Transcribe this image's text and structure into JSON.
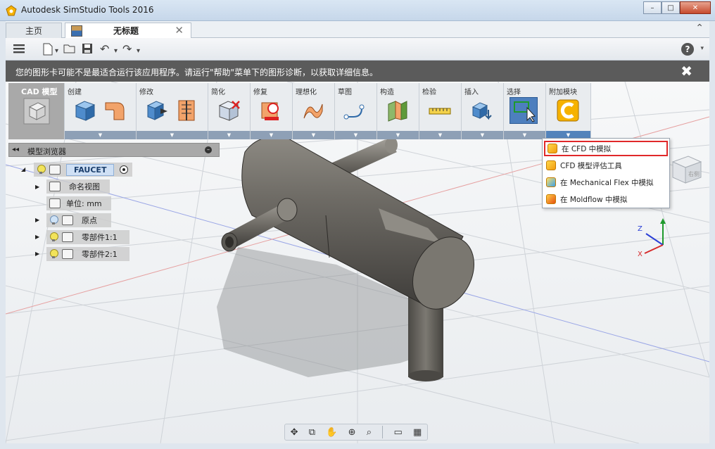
{
  "window": {
    "title": "Autodesk SimStudio Tools 2016",
    "minimize": "–",
    "maximize": "□",
    "close": "✕"
  },
  "tabs": {
    "home": "主页",
    "document": "无标题",
    "close_glyph": "✕",
    "collapse_glyph": "⌃"
  },
  "quick_toolbar": {
    "help_glyph": "?",
    "help_caret": "▾"
  },
  "warning": {
    "text": "您的图形卡可能不是最适合运行该应用程序。请运行\"帮助\"菜单下的图形诊断，以获取详细信息。",
    "close_glyph": "✖"
  },
  "ribbon": {
    "groups": [
      {
        "label": "CAD 模型",
        "icon": "cube-outline-icon"
      },
      {
        "label": "创建",
        "icon": "box-icon"
      },
      {
        "label": "修改",
        "icon": "press-pull-icon"
      },
      {
        "label": "简化",
        "icon": "simplify-icon"
      },
      {
        "label": "修复",
        "icon": "repair-icon"
      },
      {
        "label": "理想化",
        "icon": "idealize-icon"
      },
      {
        "label": "草图",
        "icon": "sketch-icon"
      },
      {
        "label": "构造",
        "icon": "construct-plane-icon"
      },
      {
        "label": "检验",
        "icon": "measure-icon"
      },
      {
        "label": "插入",
        "icon": "insert-icon"
      },
      {
        "label": "选择",
        "icon": "select-icon"
      },
      {
        "label": "附加模块",
        "icon": "addin-icon"
      }
    ],
    "drop_glyph": "▼"
  },
  "browser": {
    "title": "模型浏览器",
    "collapse_glyph": "◂◂",
    "min_glyph": "–",
    "items": [
      {
        "label": "FAUCET"
      },
      {
        "label": "命名视图"
      },
      {
        "label": "单位: mm"
      },
      {
        "label": "原点"
      },
      {
        "label": "零部件1:1"
      },
      {
        "label": "零部件2:1"
      }
    ],
    "expand_glyph": "▶",
    "collapse_tree_glyph": "◢"
  },
  "addin_menu": {
    "items": [
      {
        "label": "在 CFD 中模拟",
        "icon": "cfd-icon"
      },
      {
        "label": "CFD 模型评估工具",
        "icon": "cfd-icon"
      },
      {
        "label": "在 Mechanical Flex 中模拟",
        "icon": "mechanical-flex-icon"
      },
      {
        "label": "在 Moldflow 中模拟",
        "icon": "moldflow-icon"
      }
    ]
  },
  "viewcube": {
    "label": "右侧"
  },
  "axes": {
    "z": "Z",
    "x": "X"
  },
  "bottom_toolbar": {
    "items": [
      {
        "icon": "orbit-icon",
        "glyph": "✥"
      },
      {
        "icon": "look-at-icon",
        "glyph": "⧉"
      },
      {
        "icon": "pan-icon",
        "glyph": "✋"
      },
      {
        "icon": "zoom-icon",
        "glyph": "⊕"
      },
      {
        "icon": "fit-icon",
        "glyph": "⌕"
      },
      {
        "icon": "display-settings-icon",
        "glyph": "▭"
      },
      {
        "icon": "grid-icon",
        "glyph": "▦"
      }
    ]
  },
  "colors": {
    "accent": "#4d7fbe",
    "warning_bg": "#5b5b5b",
    "highlight_border": "#e0282a"
  }
}
